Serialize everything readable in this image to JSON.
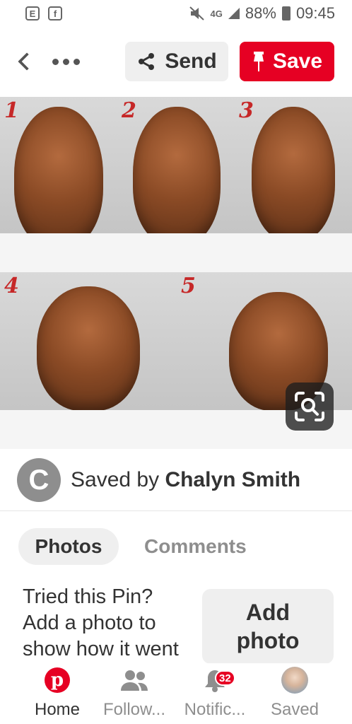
{
  "status_bar": {
    "network": "4G",
    "battery": "88%",
    "time": "09:45"
  },
  "toolbar": {
    "send_label": "Send",
    "save_label": "Save"
  },
  "pin_image": {
    "step_labels": [
      "1",
      "2",
      "3",
      "4",
      "5"
    ]
  },
  "saved_by": {
    "avatar_letter": "C",
    "prefix": "Saved by",
    "user_name": "Chalyn Smith"
  },
  "tabs": {
    "photos": "Photos",
    "comments": "Comments"
  },
  "tried": {
    "text": "Tried this Pin? Add a photo to show how it went",
    "add_photo_label": "Add photo"
  },
  "bottom_nav": {
    "home": "Home",
    "following": "Follow...",
    "notifications": "Notific...",
    "notification_count": "32",
    "saved": "Saved"
  },
  "colors": {
    "brand_red": "#e60023",
    "pill_gray": "#efefef",
    "text_dark": "#333333",
    "text_muted": "#8e8e8e"
  }
}
